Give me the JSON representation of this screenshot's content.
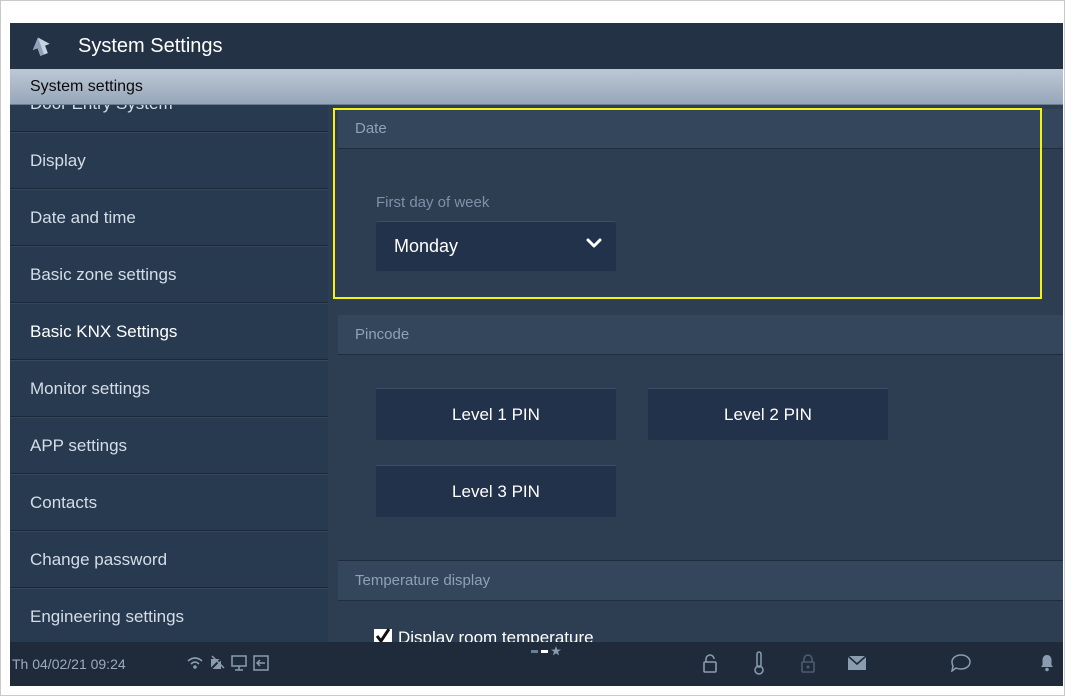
{
  "header": {
    "title": "System Settings"
  },
  "breadcrumb": {
    "label": "System settings"
  },
  "sidebar": {
    "items": [
      {
        "label": "Door Entry System"
      },
      {
        "label": "Display"
      },
      {
        "label": "Date and time"
      },
      {
        "label": "Basic zone settings"
      },
      {
        "label": "Basic KNX Settings"
      },
      {
        "label": "Monitor settings"
      },
      {
        "label": "APP settings"
      },
      {
        "label": "Contacts"
      },
      {
        "label": "Change password"
      },
      {
        "label": "Engineering settings"
      }
    ]
  },
  "date_section": {
    "heading": "Date",
    "first_day_label": "First day of week",
    "first_day_value": "Monday"
  },
  "pincode_section": {
    "heading": "Pincode",
    "level1": "Level 1 PIN",
    "level2": "Level 2 PIN",
    "level3": "Level 3 PIN"
  },
  "temperature_section": {
    "heading": "Temperature display",
    "display_room_temp_label": "Display room temperature",
    "display_room_temp_checked": true
  },
  "status_bar": {
    "datetime": "Th 04/02/21  09:24",
    "icons": [
      "wifi-icon",
      "mute-icon",
      "monitor-icon",
      "exit-icon",
      "lock-icon",
      "thermometer-icon",
      "locked-padlock-icon",
      "mail-icon",
      "chat-icon",
      "bell-icon"
    ]
  },
  "colors": {
    "highlight": "#f3f311",
    "background": "#2a3a4d",
    "header": "#243245"
  }
}
